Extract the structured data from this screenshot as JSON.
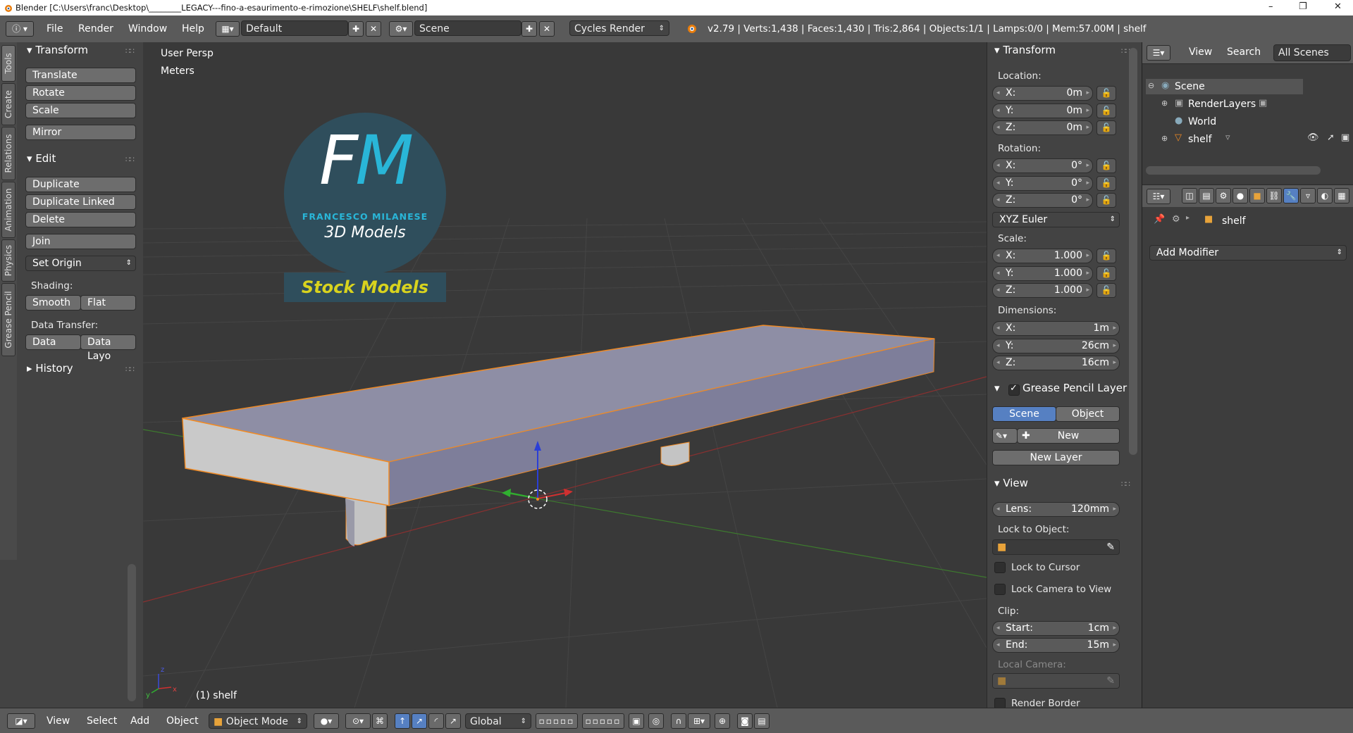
{
  "window": {
    "title": "Blender [C:\\Users\\franc\\Desktop\\________LEGACY---fino-a-esaurimento-e-rimozione\\SHELF\\shelf.blend]",
    "controls": [
      "–",
      "❐",
      "✕"
    ]
  },
  "header": {
    "menus": [
      "File",
      "Render",
      "Window",
      "Help"
    ],
    "layout": "Default",
    "scene": "Scene",
    "engine": "Cycles Render",
    "stats": "v2.79 | Verts:1,438 | Faces:1,430 | Tris:2,864 | Objects:1/1 | Lamps:0/0 | Mem:57.00M | shelf"
  },
  "vtabs": [
    "Tools",
    "Create",
    "Relations",
    "Animation",
    "Physics",
    "Grease Pencil"
  ],
  "toolshelf": {
    "transform": {
      "title": "Transform",
      "buttons": [
        "Translate",
        "Rotate",
        "Scale",
        "Mirror"
      ]
    },
    "edit": {
      "title": "Edit",
      "buttons": [
        "Duplicate",
        "Duplicate Linked",
        "Delete",
        "Join"
      ],
      "set_origin": "Set Origin",
      "shading_label": "Shading:",
      "smooth": "Smooth",
      "flat": "Flat",
      "data_transfer_label": "Data Transfer:",
      "data": "Data",
      "data_layout": "Data Layo"
    },
    "history": "History"
  },
  "viewport": {
    "view_name": "User Persp",
    "units": "Meters",
    "object_label": "(1) shelf",
    "watermark": {
      "letters": "FM",
      "name": "FRANCESCO MILANESE",
      "subtitle": "3D Models",
      "banner": "Stock Models"
    },
    "axis": {
      "x": "x",
      "y": "y",
      "z": "z"
    }
  },
  "npanel": {
    "transform_title": "Transform",
    "location_label": "Location:",
    "location": [
      {
        "k": "X:",
        "v": "0m"
      },
      {
        "k": "Y:",
        "v": "0m"
      },
      {
        "k": "Z:",
        "v": "0m"
      }
    ],
    "rotation_label": "Rotation:",
    "rotation": [
      {
        "k": "X:",
        "v": "0°"
      },
      {
        "k": "Y:",
        "v": "0°"
      },
      {
        "k": "Z:",
        "v": "0°"
      }
    ],
    "rotation_mode": "XYZ Euler",
    "scale_label": "Scale:",
    "scale": [
      {
        "k": "X:",
        "v": "1.000"
      },
      {
        "k": "Y:",
        "v": "1.000"
      },
      {
        "k": "Z:",
        "v": "1.000"
      }
    ],
    "dimensions_label": "Dimensions:",
    "dimensions": [
      {
        "k": "X:",
        "v": "1m"
      },
      {
        "k": "Y:",
        "v": "26cm"
      },
      {
        "k": "Z:",
        "v": "16cm"
      }
    ],
    "grease_title": "Grease Pencil Layer",
    "grease_scene": "Scene",
    "grease_object": "Object",
    "grease_new": "New",
    "grease_new_layer": "New Layer",
    "view_title": "View",
    "lens_k": "Lens:",
    "lens_v": "120mm",
    "lock_to_object": "Lock to Object:",
    "lock_to_cursor": "Lock to Cursor",
    "lock_camera": "Lock Camera to View",
    "clip_label": "Clip:",
    "clip_start_k": "Start:",
    "clip_start_v": "1cm",
    "clip_end_k": "End:",
    "clip_end_v": "15m",
    "local_camera": "Local Camera:",
    "render_border": "Render Border"
  },
  "outliner": {
    "view": "View",
    "search": "Search",
    "filter": "All Scenes",
    "items": [
      "Scene",
      "RenderLayers",
      "World",
      "shelf"
    ]
  },
  "properties": {
    "object": "shelf",
    "add_modifier": "Add Modifier"
  },
  "footer": {
    "menus": [
      "View",
      "Select",
      "Add",
      "Object"
    ],
    "mode": "Object Mode",
    "orientation": "Global"
  },
  "colors": {
    "accent_blue": "#5680c2",
    "selection_orange": "#f08a24",
    "mesh_face": "#8e8ea5"
  }
}
